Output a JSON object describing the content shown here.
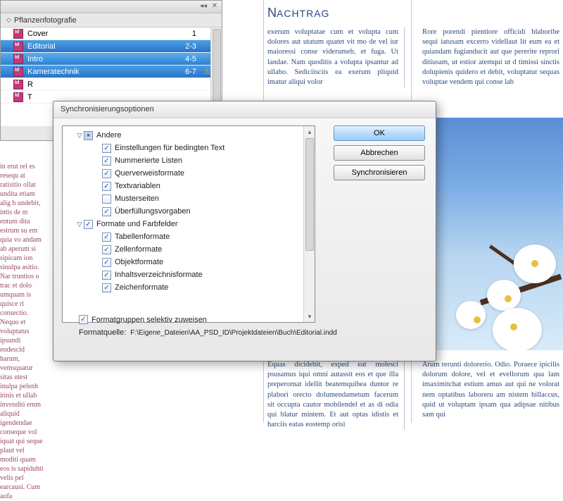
{
  "doc": {
    "heading1": "N",
    "heading2": "ACHTRAG",
    "col1": "exerum voluptatae cum et volupta cum dolores aut utatum quatet vit mo de vel iur maioressi conse viderumeb, et fuga. Ut landae. Nam quoditis a volupta ipsantur ad ullabo. Sediciisciis ea exerum pliquid imatur aliqui volor",
    "col2": "Rore porendi pientiore officidi blaboribe sequi iatusam excerro videllaut lit eum ea et quiandam fugianducit aut que pererite reprori ditiusam, ut estior atemqui ut d timissi sinctis dolupienis quidero et debit, voluptatur sequas voluptae vendem qui conse lab",
    "col1b": "Equas dicidebit, exped eat molesci psusamus iqui omni autassit eos et que illa preperornat idellit beatemquibea duntor re plabori orecto dolumendametum facerum sit occupta cautor mobilendel et as di odia qui blatur mintem. Et aut optas idistis et harciis eatas eostemp orisi",
    "col2b": "Arum rerunti dolorerio. Odio. Poraece ipicilis dolorum dolore, vel et evellorum qua lam imaximitchat estium amus aut qui ne volorat nem optatibus laboreru am nistem hillaccus, quid ut voluptam ipsam qua adipsae nitibus sam qui",
    "left": "in erut rel es resequ at ratisitio ollat undita etiam alig b undebit, intis de m entum dita estrum su em quia vo andam ab aperum si sipicam ion sinulpa asitio. Nar truntios o trac et dolo umquam is quisce ri consectio. Nequo et voluptatus ipsundi endescid harum, vemsquatur sitas utest inulpa pelenh itinis et ullab invenditi emm aliquid igendendae conseque vol iquat qui seque plaut vel moditi quam eos is sapiduhti velis pel earcausi. Cum aufa"
  },
  "panel": {
    "title": "Pflanzenfotografie",
    "rows": [
      {
        "name": "Cover",
        "pages": "1",
        "sel": false
      },
      {
        "name": "Editorial",
        "pages": "2-3",
        "sel": true
      },
      {
        "name": "Intro",
        "pages": "4-5",
        "sel": true
      },
      {
        "name": "Kameratechnik",
        "pages": "6-7",
        "sel": true,
        "warn": true
      },
      {
        "name": "R",
        "pages": "",
        "sel": false
      },
      {
        "name": "T",
        "pages": "",
        "sel": false
      }
    ]
  },
  "dialog": {
    "title": "Synchronisierungsoptionen",
    "groupA": "Andere",
    "groupB": "Formate und Farbfelder",
    "itemsA": [
      {
        "label": "Einstellungen für bedingten Text",
        "checked": true
      },
      {
        "label": "Nummerierte Listen",
        "checked": true
      },
      {
        "label": "Querverweisformate",
        "checked": true
      },
      {
        "label": "Textvariablen",
        "checked": true
      },
      {
        "label": "Musterseiten",
        "checked": false
      },
      {
        "label": "Überfüllungsvorgaben",
        "checked": true
      }
    ],
    "itemsB": [
      {
        "label": "Tabellenformate",
        "checked": true
      },
      {
        "label": "Zellenformate",
        "checked": true
      },
      {
        "label": "Objektformate",
        "checked": true
      },
      {
        "label": "Inhaltsverzeichnisformate",
        "checked": true
      },
      {
        "label": "Zeichenformate",
        "checked": true
      }
    ],
    "selective": "Formatgruppen selektiv zuweisen",
    "sourceLabel": "Formatquelle:",
    "sourcePath": "F:\\Eigene_Dateien\\AA_PSD_ID\\Projektdateien\\Buch\\Editorial.indd",
    "buttons": {
      "ok": "OK",
      "cancel": "Abbrechen",
      "sync": "Synchronisieren"
    }
  }
}
